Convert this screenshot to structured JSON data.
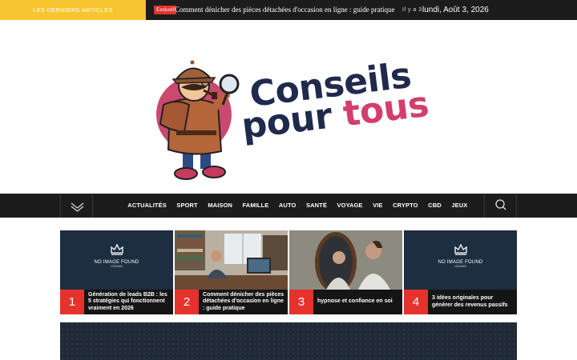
{
  "topbar": {
    "latest_label": "LES DERNIERS ARTICLES",
    "badge": "Exclusif",
    "ticker_text": "Comment dénicher des pièces détachées d'occasion en ligne : guide pratique",
    "ago": "Il y a 3",
    "date": "lundi, Août 3, 2026"
  },
  "logo": {
    "word1": "Conseils",
    "word2a": "pour",
    "word2b": "tous",
    "colors": {
      "navy": "#1f2a4d",
      "pink": "#d33f6a"
    }
  },
  "nav": {
    "items": [
      "ACTUALITÉS",
      "SPORT",
      "MAISON",
      "FAMILLE",
      "AUTO",
      "SANTÉ",
      "VOYAGE",
      "VIE",
      "CRYPTO",
      "CBD",
      "JEUX"
    ],
    "toggle_icon": "chevron-down-icon",
    "search_icon": "search-icon"
  },
  "cards": [
    {
      "num": "1",
      "title": "Génération de leads B2B : les 5 stratégies qui fonctionnent vraiment en 2026",
      "noimg": true,
      "noimg_title": "NO IMAGE FOUND",
      "noimg_size": "1200x800"
    },
    {
      "num": "2",
      "title": "Comment dénicher des pièces détachées d'occasion en ligne : guide pratique",
      "noimg": false
    },
    {
      "num": "3",
      "title": "hypnose et confiance en soi",
      "noimg": false
    },
    {
      "num": "4",
      "title": "3 idées originales pour générer des revenus passifs",
      "noimg": true,
      "noimg_title": "NO IMAGE FOUND",
      "noimg_size": "1200x800"
    }
  ],
  "colors": {
    "accent_yellow": "#f7c52f",
    "accent_red": "#e5322d",
    "dark": "#1c1c1c",
    "card_bg": "#1c2e40"
  }
}
